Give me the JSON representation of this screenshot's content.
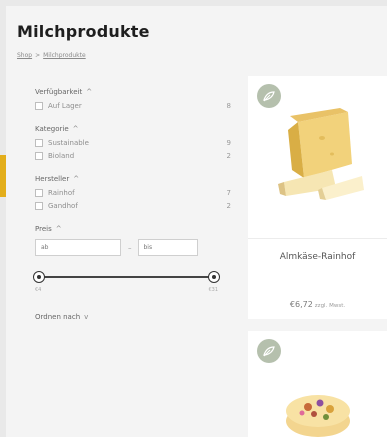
{
  "page": {
    "title": "Milchprodukte",
    "breadcrumb": [
      "Shop",
      "Milchprodukte"
    ],
    "breadcrumb_separator": ">"
  },
  "filters": {
    "availability": {
      "title": "Verfügbarkeit",
      "options": [
        {
          "label": "Auf Lager",
          "count": "8"
        }
      ]
    },
    "category": {
      "title": "Kategorie",
      "options": [
        {
          "label": "Sustainable",
          "count": "9"
        },
        {
          "label": "Bioland",
          "count": "2"
        }
      ]
    },
    "manufacturer": {
      "title": "Hersteller",
      "options": [
        {
          "label": "Rainhof",
          "count": "7"
        },
        {
          "label": "Gandhof",
          "count": "2"
        }
      ]
    },
    "price": {
      "title": "Preis",
      "from_placeholder": "ab",
      "to_placeholder": "bis",
      "separator": "–",
      "min_label": "€4",
      "max_label": "€31"
    },
    "sort_label": "Ordnen nach"
  },
  "products": [
    {
      "name": "Almkäse-Rainhof",
      "price": "€6,72",
      "vat_note": "zzgl. Mwst."
    },
    {
      "name": "",
      "price": "",
      "vat_note": ""
    }
  ],
  "colors": {
    "accent": "#e3ae1b",
    "badge": "#b5c0ad",
    "background": "#f4f4f4"
  },
  "icons": {
    "caret_up": "^",
    "caret_down": "v"
  }
}
